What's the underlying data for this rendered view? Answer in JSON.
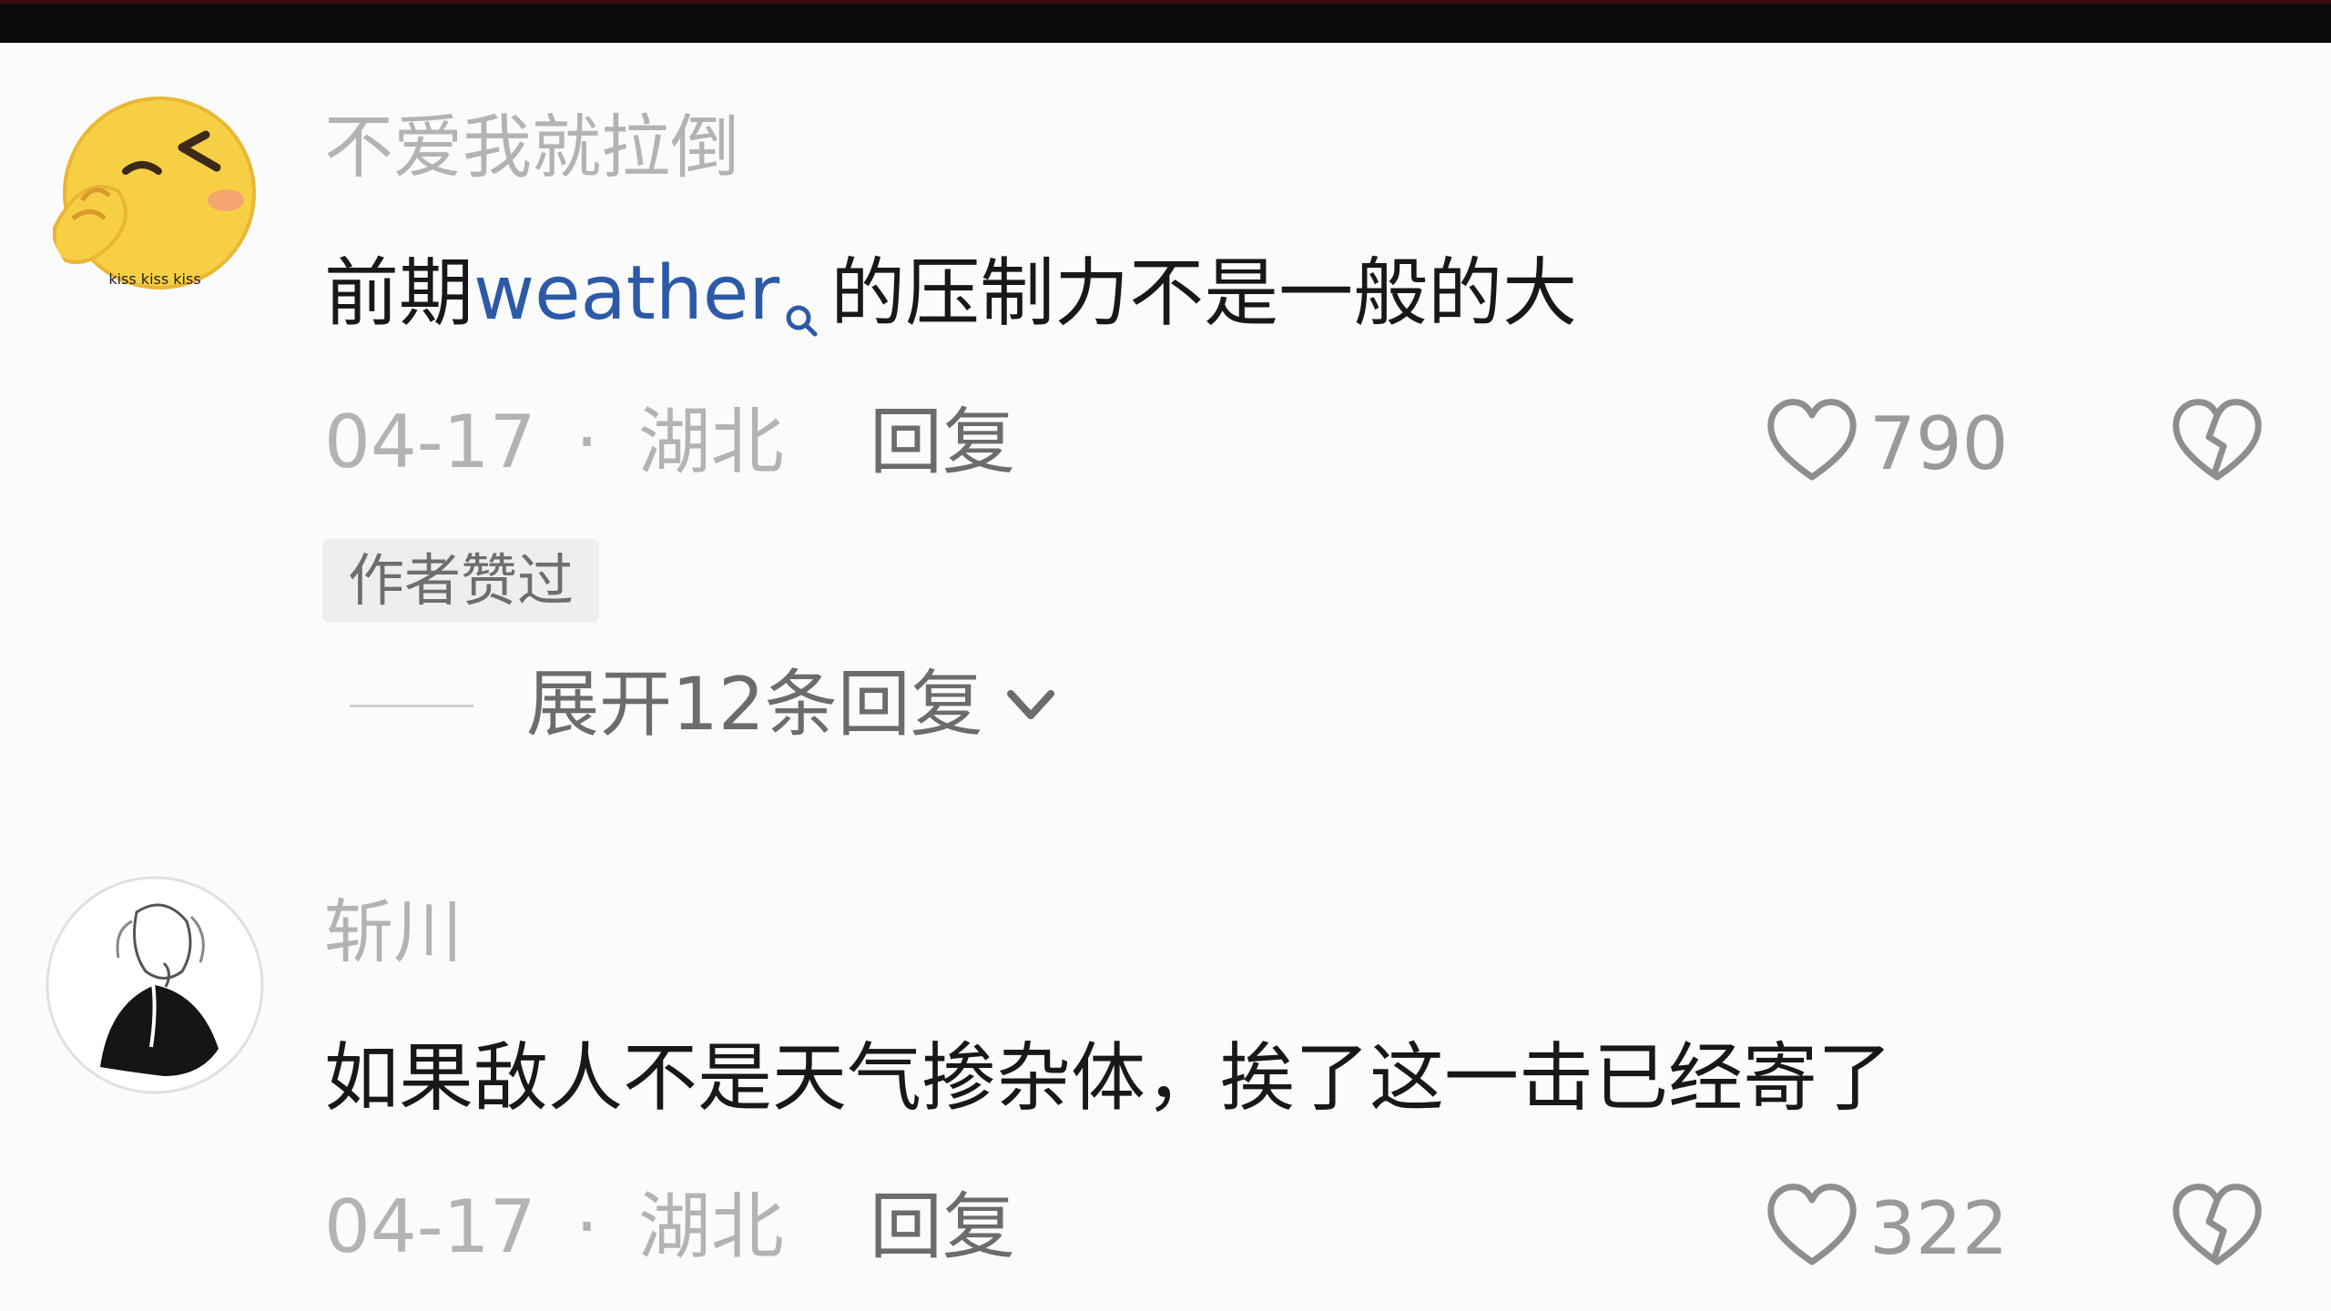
{
  "comments": [
    {
      "username": "不爱我就拉倒",
      "content_before": "前期",
      "content_link": "weather",
      "content_after": "的压制力不是一般的大",
      "date": "04-17",
      "separator": "·",
      "location": "湖北",
      "reply_label": "回复",
      "likes": "790",
      "badge": "作者赞过",
      "expand_label": "展开12条回复",
      "avatar_text": "kiss kiss kiss"
    },
    {
      "username": "斩川",
      "content": "如果敌人不是天气掺杂体，挨了这一击已经寄了",
      "date": "04-17",
      "separator": "·",
      "location": "湖北",
      "reply_label": "回复",
      "likes": "322"
    }
  ],
  "colors": {
    "username": "#b3b3b3",
    "link": "#2c5aa8",
    "text": "#181818",
    "badge_bg": "#eeeeee"
  },
  "icons": {
    "like": "heart-outline-icon",
    "dislike": "broken-heart-icon",
    "search": "search-icon",
    "expand": "chevron-down-icon"
  }
}
